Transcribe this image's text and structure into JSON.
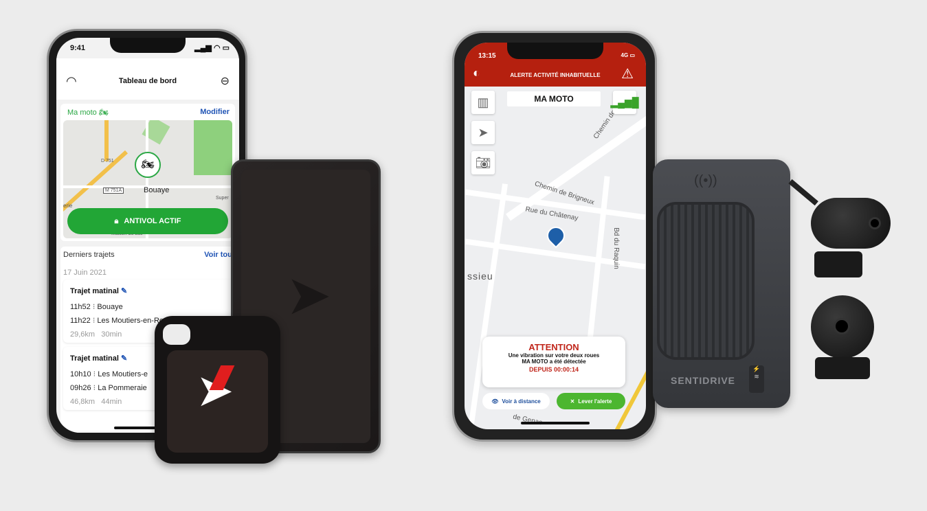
{
  "left_app": {
    "status_time": "9:41",
    "title": "Tableau de bord",
    "vehicle_label": "Ma moto",
    "edit_label": "Modifier",
    "map_labels": [
      "D 751",
      "M 751A",
      "Bouaye",
      "Super",
      "erie",
      "Maison du Lac"
    ],
    "antitheft_button": "ANTIVOL ACTIF",
    "recent_trips_label": "Derniers trajets",
    "see_all_label": "Voir tous",
    "date": "17 Juin 2021",
    "trips": [
      {
        "title": "Trajet matinal",
        "end_time": "11h52",
        "end_place": "Bouaye",
        "start_time": "11h22",
        "start_place": "Les Moutiers-en-Re",
        "distance": "29,6km",
        "duration": "30min"
      },
      {
        "title": "Trajet matinal",
        "end_time": "10h10",
        "end_place": "Les Moutiers-e",
        "start_time": "09h26",
        "start_place": "La Pommeraie",
        "distance": "46,8km",
        "duration": "44min"
      }
    ],
    "accent_green": "#2aa744",
    "accent_blue": "#2155b5"
  },
  "right_app": {
    "status_time": "13:15",
    "network": "4G",
    "alert_header": "ALERTE ACTIVITÉ INHABITUELLE",
    "vehicle_name": "MA MOTO",
    "map_labels": [
      "Chemin de",
      "Chemin de Brigneux",
      "Rue du Châtenay",
      "Bd du Raquin",
      "ssieu",
      "de Genas"
    ],
    "alert_title": "ATTENTION",
    "alert_line1": "Une vibration sur votre deux roues",
    "alert_line2": "MA MOTO a été détectée",
    "alert_since": "DEPUIS 00:00:14",
    "view_remote_button": "Voir à distance",
    "dismiss_alert_button": "Lever l'alerte",
    "header_color": "#b5200f",
    "accent_green": "#4cb630"
  },
  "device": {
    "brand": "SENTIDRIVE"
  }
}
